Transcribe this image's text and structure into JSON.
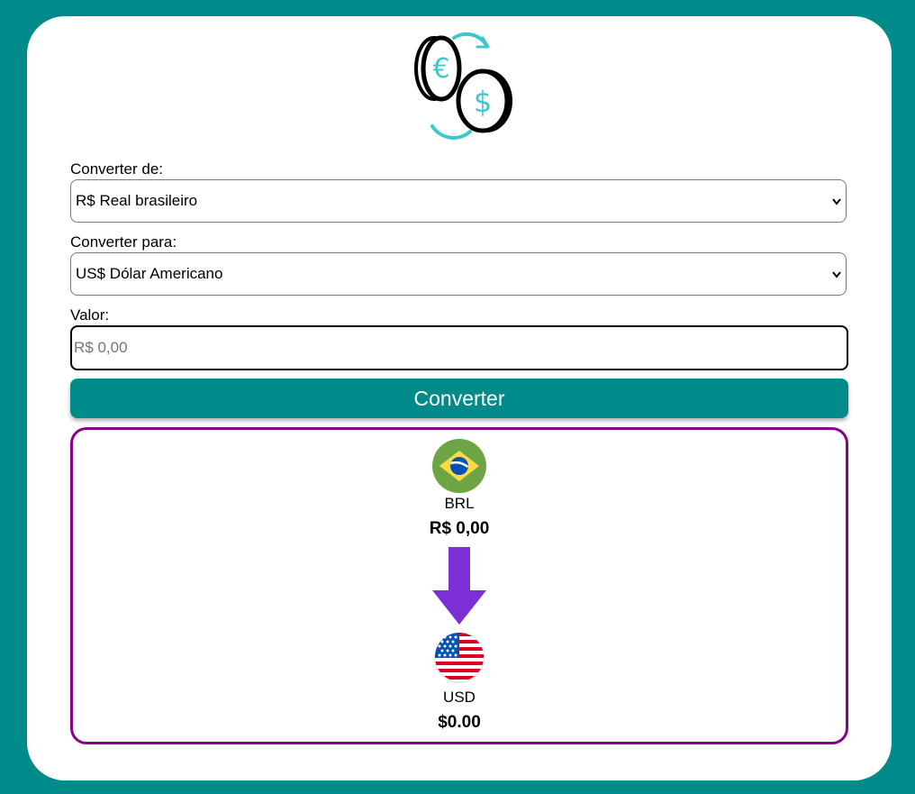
{
  "form": {
    "from_label": "Converter de:",
    "from_selected": "R$ Real brasileiro",
    "to_label": "Converter para:",
    "to_selected": "US$ Dólar Americano",
    "value_label": "Valor:",
    "value_placeholder": "R$ 0,00",
    "value_current": "",
    "convert_button": "Converter"
  },
  "result": {
    "from_code": "BRL",
    "from_amount": "R$ 0,00",
    "to_code": "USD",
    "to_amount": "$0.00"
  },
  "icons": {
    "logo": "currency-exchange-icon",
    "from_flag": "brazil-flag-icon",
    "to_flag": "usa-flag-icon",
    "arrow": "arrow-down-icon",
    "dropdown": "chevron-down-icon"
  },
  "colors": {
    "background": "#008b8a",
    "button": "#008b8a",
    "result_border": "#8a008a",
    "arrow": "#7b2fd4",
    "accent_teal": "#3cc8cf"
  }
}
